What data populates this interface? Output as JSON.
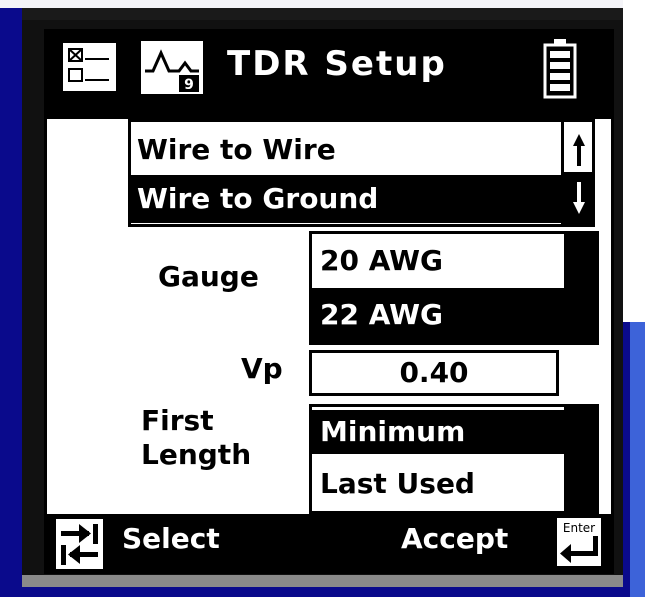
{
  "header": {
    "title": "TDR Setup",
    "icons": [
      "menu-checklist-icon",
      "waveform-icon",
      "battery-icon"
    ],
    "waveform_badge": "9"
  },
  "mode_list": {
    "items": [
      {
        "label": "Wire to Wire",
        "selected": false
      },
      {
        "label": "Wire to Ground",
        "selected": true
      }
    ]
  },
  "gauge": {
    "label": "Gauge",
    "options": [
      {
        "label": "20 AWG",
        "selected": false
      },
      {
        "label": "22 AWG",
        "selected": true
      }
    ]
  },
  "vp": {
    "label": "Vp",
    "value": "0.40"
  },
  "first_length": {
    "label_line1": "First",
    "label_line2": "Length",
    "options": [
      {
        "label": "Minimum",
        "selected": true
      },
      {
        "label": "Last Used",
        "selected": false
      }
    ]
  },
  "footer": {
    "select_label": "Select",
    "accept_label": "Accept",
    "enter_key_label": "Enter"
  },
  "colors": {
    "slide_background": "#0a0a8c",
    "screen_background": "#ffffff",
    "highlight": "#000000"
  }
}
